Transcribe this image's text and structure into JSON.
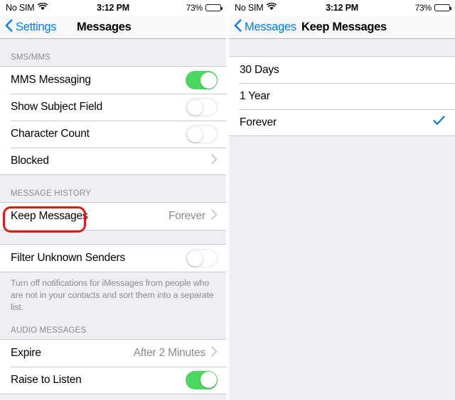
{
  "status_bar": {
    "carrier": "No SIM",
    "wifi_icon": "wifi-icon",
    "time": "3:12 PM",
    "battery_percent": "73%",
    "battery_icon": "battery-icon"
  },
  "left_screen": {
    "nav": {
      "back_label": "Settings",
      "back_icon": "chevron-left-icon",
      "title": "Messages"
    },
    "sections": [
      {
        "header": "SMS/MMS",
        "rows": [
          {
            "label": "MMS Messaging",
            "type": "toggle",
            "value": "on"
          },
          {
            "label": "Show Subject Field",
            "type": "toggle",
            "value": "off"
          },
          {
            "label": "Character Count",
            "type": "toggle",
            "value": "off"
          },
          {
            "label": "Blocked",
            "type": "disclosure",
            "value": ""
          }
        ]
      },
      {
        "header": "MESSAGE HISTORY",
        "rows": [
          {
            "label": "Keep Messages",
            "type": "disclosure",
            "value": "Forever"
          }
        ]
      },
      {
        "header": "",
        "rows": [
          {
            "label": "Filter Unknown Senders",
            "type": "toggle",
            "value": "off"
          }
        ],
        "footer": "Turn off notifications for iMessages from people who are not in your contacts and sort them into a separate list."
      },
      {
        "header": "AUDIO MESSAGES",
        "rows": [
          {
            "label": "Expire",
            "type": "disclosure",
            "value": "After 2 Minutes"
          },
          {
            "label": "Raise to Listen",
            "type": "toggle",
            "value": "on"
          }
        ]
      }
    ],
    "highlight": {
      "name": "keep-messages-highlight",
      "color": "#e01b12"
    }
  },
  "right_screen": {
    "nav": {
      "back_label": "Messages",
      "back_icon": "chevron-left-icon",
      "title": "Keep Messages"
    },
    "options": [
      {
        "label": "30 Days",
        "selected": false
      },
      {
        "label": "1 Year",
        "selected": false
      },
      {
        "label": "Forever",
        "selected": true
      }
    ],
    "check_icon": "checkmark-icon",
    "accent_color": "#007aff"
  },
  "colors": {
    "toggle_on": "#4cd763",
    "tint": "#007aff",
    "group_bg": "#efeef3",
    "separator": "#c8c7cc",
    "secondary_text": "#8a8a8f"
  }
}
